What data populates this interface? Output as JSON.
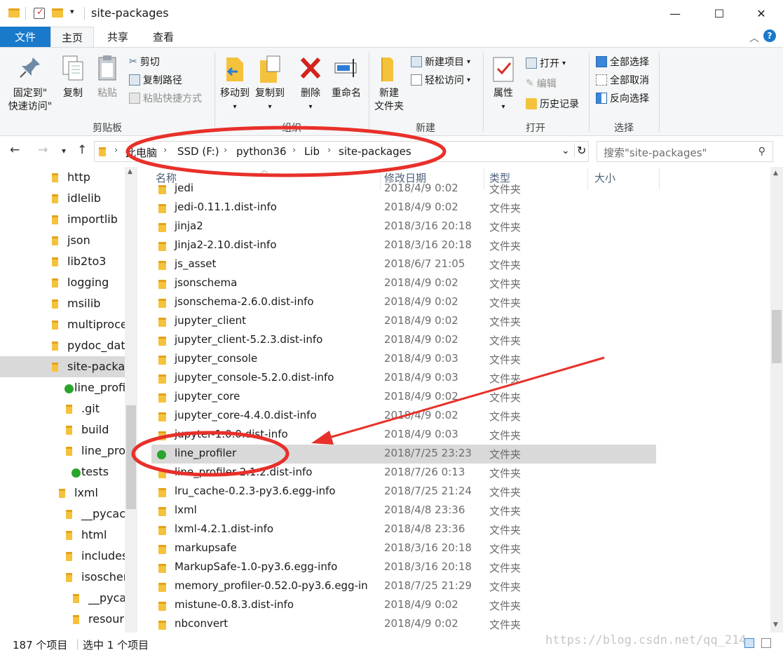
{
  "window": {
    "title": "site-packages",
    "minimize": "—",
    "maximize": "☐",
    "close": "✕"
  },
  "ribbon_tabs": [
    "文件",
    "主页",
    "共享",
    "查看"
  ],
  "ribbon": {
    "clipboard": {
      "pin": "固定到\"",
      "pin2": "快速访问\"",
      "copy": "复制",
      "paste": "粘贴",
      "cut": "剪切",
      "copy_path": "复制路径",
      "paste_shortcut": "粘贴快捷方式",
      "label": "剪贴板"
    },
    "organize": {
      "move_to": "移动到",
      "copy_to": "复制到",
      "delete": "删除",
      "rename": "重命名",
      "label": "组织"
    },
    "new": {
      "new_folder1": "新建",
      "new_folder2": "文件夹",
      "new_item": "新建项目",
      "easy_access": "轻松访问",
      "label": "新建"
    },
    "open": {
      "properties": "属性",
      "open": "打开",
      "edit": "编辑",
      "history": "历史记录",
      "label": "打开"
    },
    "select": {
      "select_all": "全部选择",
      "select_none": "全部取消",
      "invert": "反向选择",
      "label": "选择"
    }
  },
  "address": {
    "crumbs": [
      "此电脑",
      "SSD (F:)",
      "python36",
      "Lib",
      "site-packages"
    ],
    "search_placeholder": "搜索\"site-packages\""
  },
  "tree": [
    {
      "label": "http",
      "indent": 0,
      "icon": "folder-icon"
    },
    {
      "label": "idlelib",
      "indent": 0,
      "icon": "folder-icon"
    },
    {
      "label": "importlib",
      "indent": 0,
      "icon": "folder-icon"
    },
    {
      "label": "json",
      "indent": 0,
      "icon": "folder-icon"
    },
    {
      "label": "lib2to3",
      "indent": 0,
      "icon": "folder-icon"
    },
    {
      "label": "logging",
      "indent": 0,
      "icon": "folder-icon"
    },
    {
      "label": "msilib",
      "indent": 0,
      "icon": "folder-icon"
    },
    {
      "label": "multiproce",
      "indent": 0,
      "icon": "folder-icon"
    },
    {
      "label": "pydoc_data",
      "indent": 0,
      "icon": "folder-icon"
    },
    {
      "label": "site-packag",
      "indent": 0,
      "icon": "folder-icon",
      "selected": true
    },
    {
      "label": "line_profi",
      "indent": 1,
      "icon": "svn-ok-icon"
    },
    {
      "label": ".git",
      "indent": 2,
      "icon": "folder-icon"
    },
    {
      "label": "build",
      "indent": 2,
      "icon": "folder-icon"
    },
    {
      "label": "line_pro",
      "indent": 2,
      "icon": "folder-icon"
    },
    {
      "label": "tests",
      "indent": 2,
      "icon": "svn-ok-icon"
    },
    {
      "label": "lxml",
      "indent": 1,
      "icon": "folder-icon"
    },
    {
      "label": "__pycach",
      "indent": 2,
      "icon": "folder-icon"
    },
    {
      "label": "html",
      "indent": 2,
      "icon": "folder-icon"
    },
    {
      "label": "includes",
      "indent": 2,
      "icon": "folder-icon"
    },
    {
      "label": "isoscher",
      "indent": 2,
      "icon": "folder-icon"
    },
    {
      "label": "__pyca",
      "indent": 3,
      "icon": "folder-icon"
    },
    {
      "label": "resour",
      "indent": 3,
      "icon": "folder-icon"
    }
  ],
  "columns": {
    "name": "名称",
    "date": "修改日期",
    "type": "类型",
    "size": "大小"
  },
  "files": [
    {
      "name": "jedi",
      "date": "2018/4/9 0:02",
      "type": "文件夹"
    },
    {
      "name": "jedi-0.11.1.dist-info",
      "date": "2018/4/9 0:02",
      "type": "文件夹"
    },
    {
      "name": "jinja2",
      "date": "2018/3/16 20:18",
      "type": "文件夹"
    },
    {
      "name": "Jinja2-2.10.dist-info",
      "date": "2018/3/16 20:18",
      "type": "文件夹"
    },
    {
      "name": "js_asset",
      "date": "2018/6/7 21:05",
      "type": "文件夹"
    },
    {
      "name": "jsonschema",
      "date": "2018/4/9 0:02",
      "type": "文件夹"
    },
    {
      "name": "jsonschema-2.6.0.dist-info",
      "date": "2018/4/9 0:02",
      "type": "文件夹"
    },
    {
      "name": "jupyter_client",
      "date": "2018/4/9 0:02",
      "type": "文件夹"
    },
    {
      "name": "jupyter_client-5.2.3.dist-info",
      "date": "2018/4/9 0:02",
      "type": "文件夹"
    },
    {
      "name": "jupyter_console",
      "date": "2018/4/9 0:03",
      "type": "文件夹"
    },
    {
      "name": "jupyter_console-5.2.0.dist-info",
      "date": "2018/4/9 0:03",
      "type": "文件夹"
    },
    {
      "name": "jupyter_core",
      "date": "2018/4/9 0:02",
      "type": "文件夹"
    },
    {
      "name": "jupyter_core-4.4.0.dist-info",
      "date": "2018/4/9 0:02",
      "type": "文件夹"
    },
    {
      "name": "jupyter-1.0.0.dist-info",
      "date": "2018/4/9 0:03",
      "type": "文件夹"
    },
    {
      "name": "line_profiler",
      "date": "2018/7/25 23:23",
      "type": "文件夹",
      "selected": true,
      "icon": "svn-ok-icon"
    },
    {
      "name": "line_profiler-2.1.2.dist-info",
      "date": "2018/7/26 0:13",
      "type": "文件夹"
    },
    {
      "name": "lru_cache-0.2.3-py3.6.egg-info",
      "date": "2018/7/25 21:24",
      "type": "文件夹"
    },
    {
      "name": "lxml",
      "date": "2018/4/8 23:36",
      "type": "文件夹"
    },
    {
      "name": "lxml-4.2.1.dist-info",
      "date": "2018/4/8 23:36",
      "type": "文件夹"
    },
    {
      "name": "markupsafe",
      "date": "2018/3/16 20:18",
      "type": "文件夹"
    },
    {
      "name": "MarkupSafe-1.0-py3.6.egg-info",
      "date": "2018/3/16 20:18",
      "type": "文件夹"
    },
    {
      "name": "memory_profiler-0.52.0-py3.6.egg-in",
      "date": "2018/7/25 21:29",
      "type": "文件夹"
    },
    {
      "name": "mistune-0.8.3.dist-info",
      "date": "2018/4/9 0:02",
      "type": "文件夹"
    },
    {
      "name": "nbconvert",
      "date": "2018/4/9 0:02",
      "type": "文件夹"
    }
  ],
  "status": {
    "count": "187 个项目",
    "selected": "选中 1 个项目"
  },
  "watermark": "https://blog.csdn.net/qq_214",
  "colors": {
    "accent": "#1979ca",
    "folder": "#f5c23c",
    "annotation": "#e8302a",
    "selection": "#d9d9d9"
  }
}
